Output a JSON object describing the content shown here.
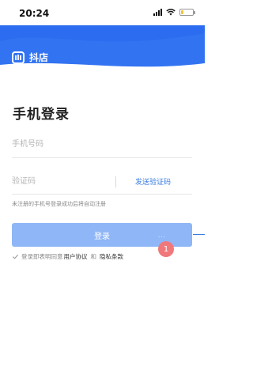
{
  "status_bar": {
    "time": "20:24",
    "signal_icon": "signal-bars-icon",
    "wifi_icon": "wifi-icon",
    "battery_icon": "battery-low-icon",
    "battery_level": 0.2
  },
  "header": {
    "brand_name": "抖店",
    "logo_icon": "doudian-logo-icon",
    "background_color": "#2b6cf0"
  },
  "form": {
    "title": "手机登录",
    "phone_placeholder": "手机号码",
    "code_placeholder": "验证码",
    "send_code_label": "发送验证码",
    "hint": "未注册的手机号登录成功后将自动注册",
    "login_label": "登录",
    "login_color": "#8fb6f6",
    "more_indicator": "...",
    "agreement_prefix": "登录即表明同意",
    "user_agreement": "用户协议",
    "agreement_and": "和",
    "privacy_policy": "隐私条款"
  },
  "annotation": {
    "badge_number": "1",
    "badge_color": "#f0787a"
  }
}
